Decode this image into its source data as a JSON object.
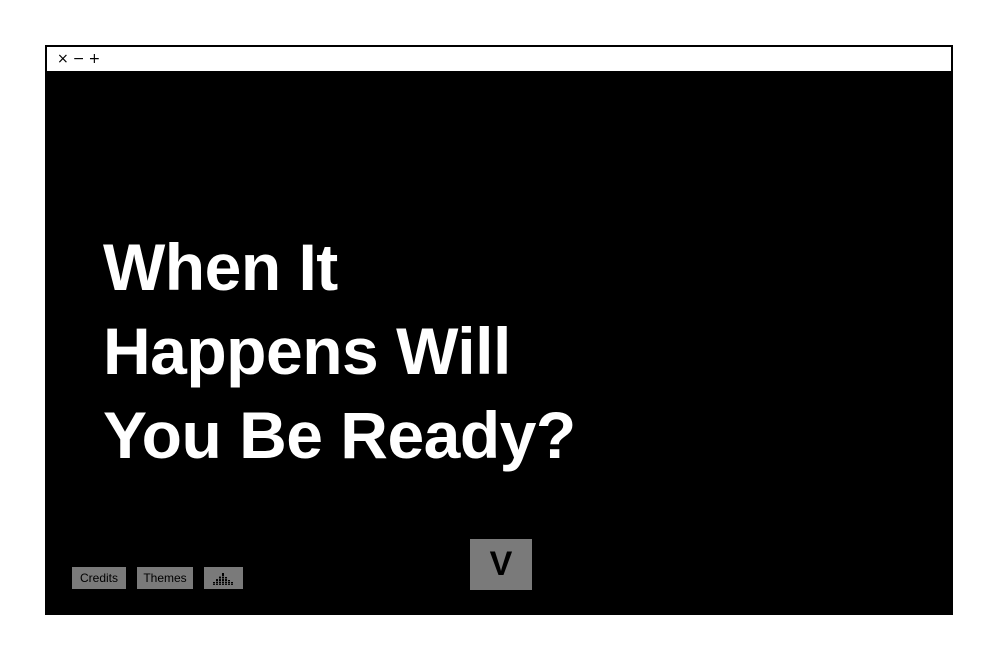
{
  "window": {
    "controls": {
      "close": "×",
      "minimize": "−",
      "maximize": "+"
    }
  },
  "main": {
    "headline": {
      "line1": "When It",
      "line2": "Happens Will",
      "line3": "You Be Ready?"
    }
  },
  "footer": {
    "credits_label": "Credits",
    "themes_label": "Themes",
    "audio_icon": "equalizer-icon",
    "next_label": "V"
  },
  "colors": {
    "background": "#000000",
    "frame": "#ffffff",
    "headline_text": "#ffffff",
    "button_bg": "#7a7a7a",
    "button_text": "#000000"
  }
}
